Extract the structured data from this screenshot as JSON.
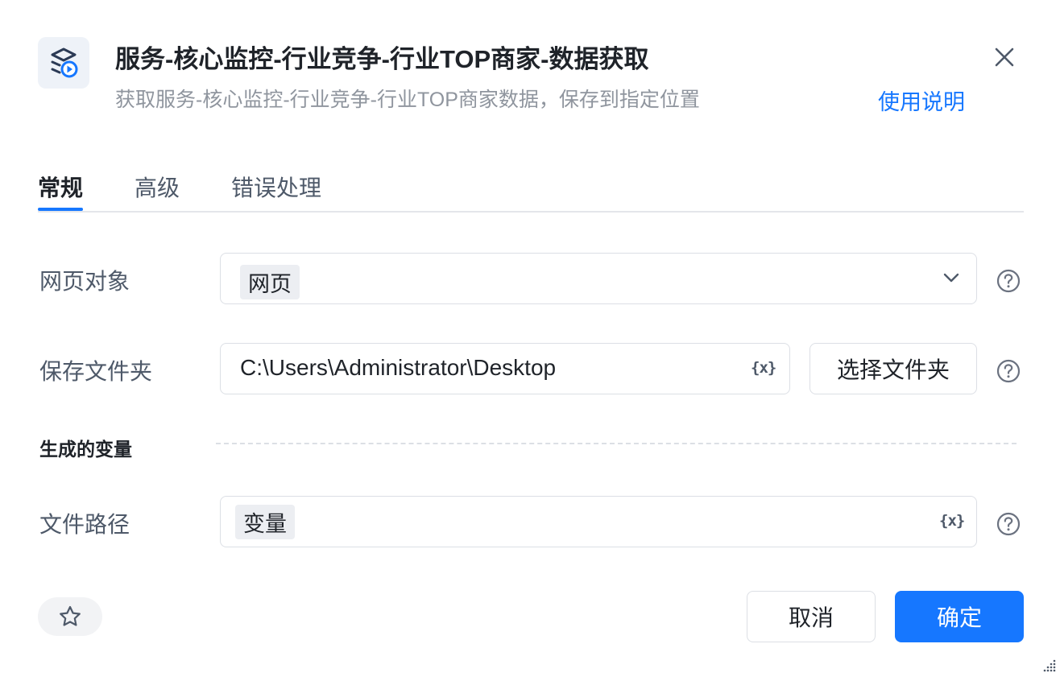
{
  "header": {
    "title": "服务-核心监控-行业竞争-行业TOP商家-数据获取",
    "subtitle": "获取服务-核心监控-行业竞争-行业TOP商家数据，保存到指定位置",
    "help_link": "使用说明",
    "app_icon": "layers-play-icon",
    "close_icon": "close-icon"
  },
  "tabs": [
    {
      "label": "常规",
      "active": true
    },
    {
      "label": "高级",
      "active": false
    },
    {
      "label": "错误处理",
      "active": false
    }
  ],
  "form": {
    "web_object": {
      "label": "网页对象",
      "value_tag": "网页",
      "icon": "chevron-down-icon"
    },
    "save_folder": {
      "label": "保存文件夹",
      "value": "C:\\Users\\Administrator\\Desktop",
      "var_icon_text": "{x}",
      "select_button": "选择文件夹"
    },
    "generated_vars": {
      "section_title": "生成的变量"
    },
    "file_path": {
      "label": "文件路径",
      "value_tag": "变量",
      "var_icon_text": "{x}"
    }
  },
  "footer": {
    "favorite_icon": "star-icon",
    "cancel": "取消",
    "confirm": "确定"
  },
  "colors": {
    "accent": "#1677ff",
    "text_primary": "#1f2329",
    "text_secondary": "#8f959e",
    "border": "#dcdfe5"
  }
}
